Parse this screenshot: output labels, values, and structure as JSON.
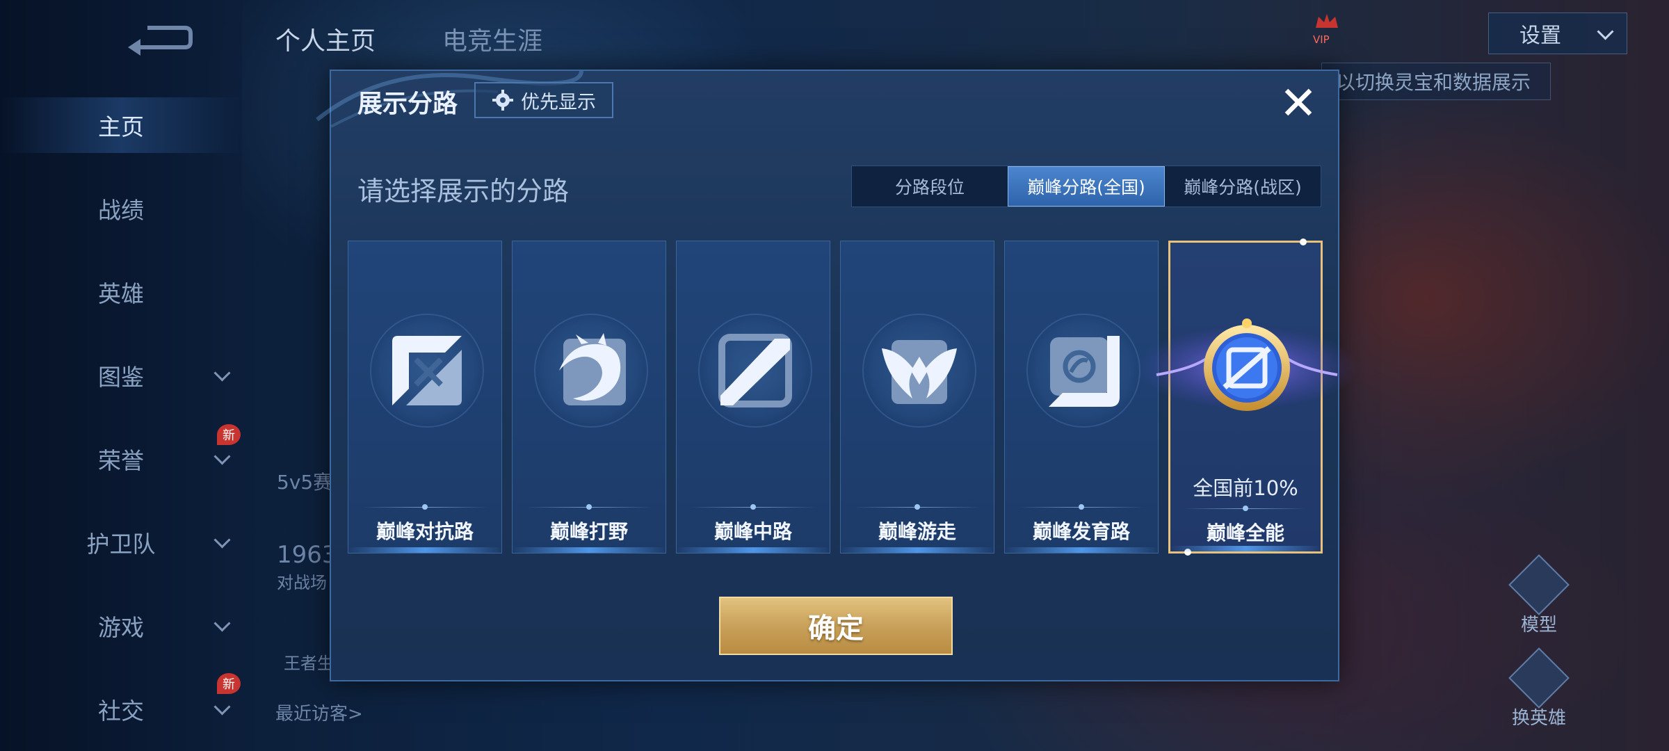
{
  "background": {
    "top_tabs": [
      "个人主页",
      "电竞生涯"
    ],
    "settings_label": "设置",
    "vip_label": "VIP",
    "right_hint": "以切换灵宝和数据展示",
    "behind_texts": [
      "5v5赛事",
      "1963",
      "对战场",
      "王者生",
      "最近访客>"
    ],
    "side_actions": [
      "模型",
      "换英雄"
    ]
  },
  "sidebar": {
    "items": [
      {
        "label": "主页",
        "chevron": false,
        "badge": ""
      },
      {
        "label": "战绩",
        "chevron": false,
        "badge": ""
      },
      {
        "label": "英雄",
        "chevron": false,
        "badge": ""
      },
      {
        "label": "图鉴",
        "chevron": true,
        "badge": ""
      },
      {
        "label": "荣誉",
        "chevron": true,
        "badge": "新"
      },
      {
        "label": "护卫队",
        "chevron": true,
        "badge": ""
      },
      {
        "label": "游戏",
        "chevron": true,
        "badge": ""
      },
      {
        "label": "社交",
        "chevron": true,
        "badge": "新"
      }
    ]
  },
  "modal": {
    "title": "展示分路",
    "priority_button": "优先显示",
    "close_symbol": "✕",
    "subtitle": "请选择展示的分路",
    "segments": [
      "分路段位",
      "巅峰分路(全国)",
      "巅峰分路(战区)"
    ],
    "active_segment": 1,
    "cards": [
      {
        "label": "巅峰对抗路",
        "icon": "clash-lane-icon",
        "stat": ""
      },
      {
        "label": "巅峰打野",
        "icon": "jungle-dragon-icon",
        "stat": ""
      },
      {
        "label": "巅峰中路",
        "icon": "mid-lane-icon",
        "stat": ""
      },
      {
        "label": "巅峰游走",
        "icon": "roam-wings-icon",
        "stat": ""
      },
      {
        "label": "巅峰发育路",
        "icon": "farm-lane-icon",
        "stat": ""
      },
      {
        "label": "巅峰全能",
        "icon": "all-round-emblem-icon",
        "stat": "全国前10%",
        "selected": true
      }
    ],
    "confirm_label": "确定"
  },
  "colors": {
    "accent_blue": "#2e63aa",
    "gold": "#c9a15a",
    "selected_border": "#e8c27a"
  }
}
